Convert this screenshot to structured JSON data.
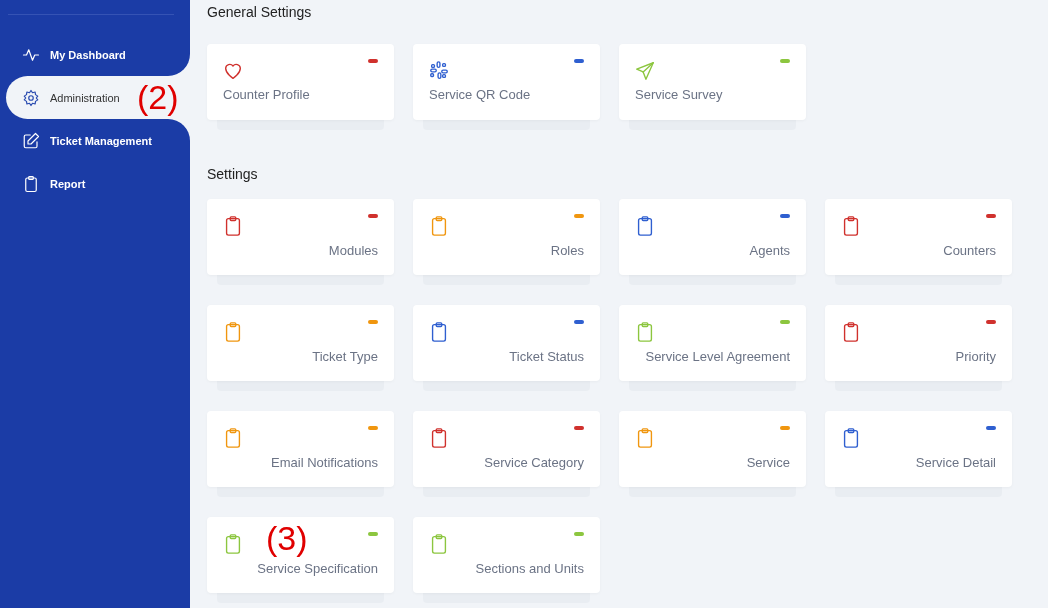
{
  "sidebar": {
    "items": [
      {
        "label": "My Dashboard",
        "selected": false
      },
      {
        "label": "Administration",
        "selected": true,
        "annotation": "(2)"
      },
      {
        "label": "Ticket Management",
        "selected": false
      },
      {
        "label": "Report",
        "selected": false
      }
    ]
  },
  "sections": [
    {
      "title": "General Settings",
      "kind": "general",
      "cards": [
        {
          "label": "Counter Profile",
          "color": "#d0312d"
        },
        {
          "label": "Service QR Code",
          "color": "#2f5fd0"
        },
        {
          "label": "Service Survey",
          "color": "#8cc63f"
        }
      ]
    },
    {
      "title": "Settings",
      "kind": "settings",
      "cards": [
        {
          "label": "Modules",
          "color": "#d0312d"
        },
        {
          "label": "Roles",
          "color": "#f0960f"
        },
        {
          "label": "Agents",
          "color": "#2f5fd0"
        },
        {
          "label": "Counters",
          "color": "#d0312d"
        },
        {
          "label": "Ticket Type",
          "color": "#f0960f"
        },
        {
          "label": "Ticket Status",
          "color": "#2f5fd0"
        },
        {
          "label": "Service Level Agreement",
          "color": "#8cc63f"
        },
        {
          "label": "Priority",
          "color": "#d0312d"
        },
        {
          "label": "Email Notifications",
          "color": "#f0960f"
        },
        {
          "label": "Service Category",
          "color": "#d0312d"
        },
        {
          "label": "Service",
          "color": "#f0960f"
        },
        {
          "label": "Service Detail",
          "color": "#2f5fd0"
        },
        {
          "label": "Service Specification",
          "color": "#8cc63f",
          "annotation": "(3)"
        },
        {
          "label": "Sections and Units",
          "color": "#8cc63f"
        }
      ]
    }
  ]
}
